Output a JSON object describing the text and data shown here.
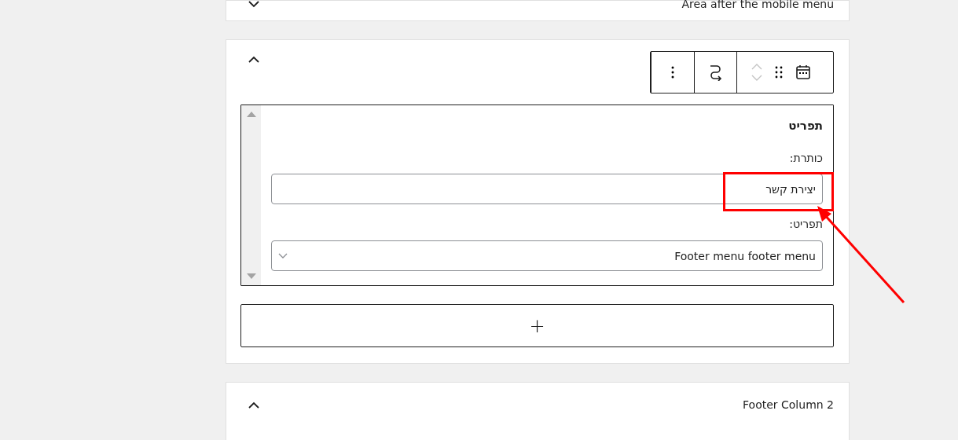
{
  "panels": [
    {
      "title": "Area after the mobile menu",
      "expanded": false
    },
    {
      "expanded": true,
      "toolbar": {
        "movers_disabled": true
      },
      "widget": {
        "title": "תפריט",
        "fields": [
          {
            "kind": "text",
            "label": "כותרת:",
            "value": "יצירת קשר"
          },
          {
            "kind": "select",
            "label": "תפריט:",
            "value": "Footer menu footer menu"
          }
        ]
      },
      "add_button": "+"
    },
    {
      "title": "Footer Column 2",
      "expanded": true
    }
  ]
}
